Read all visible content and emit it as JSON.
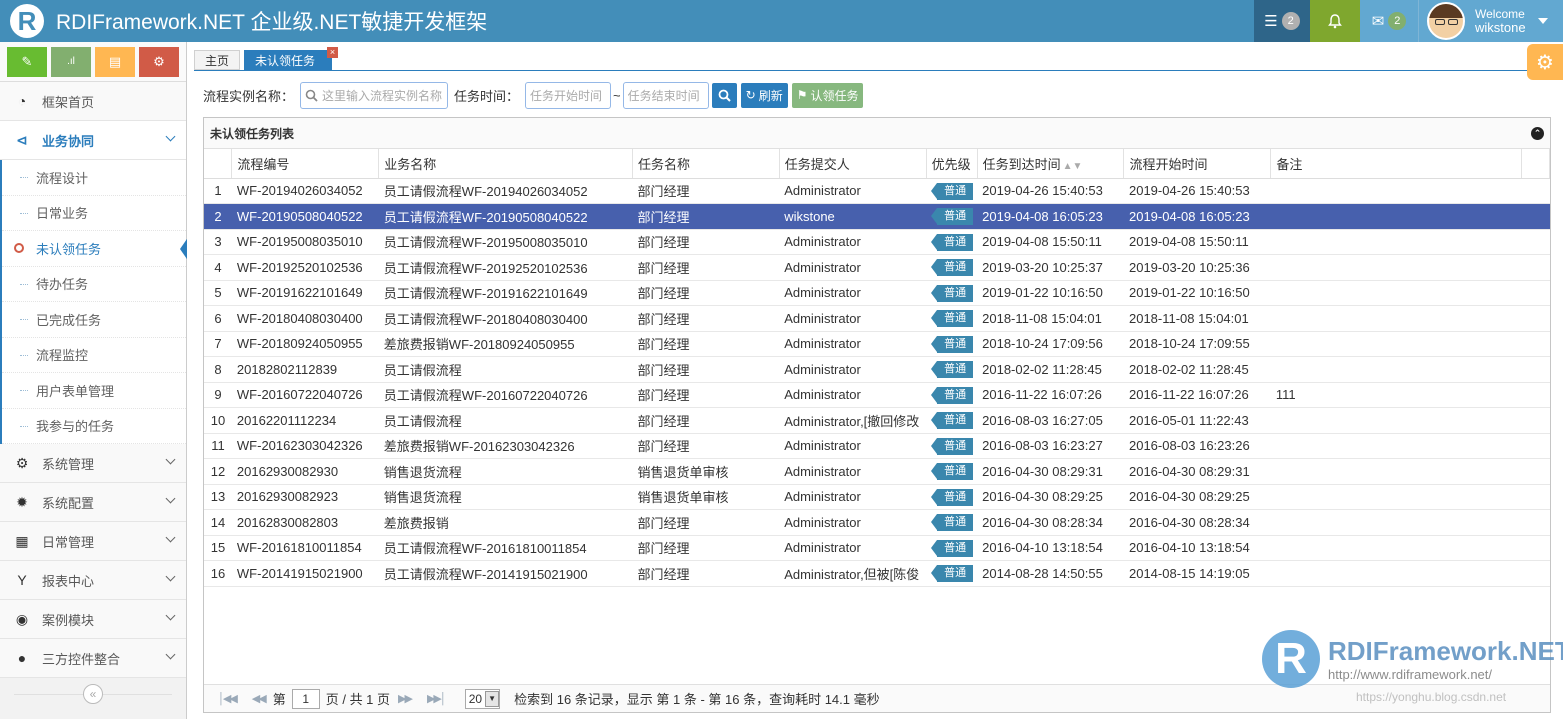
{
  "header": {
    "brand_logo": "R",
    "brand_title": "RDIFramework.NET 企业级.NET敏捷开发框架",
    "tasks_badge": "2",
    "mail_badge": "2",
    "welcome": "Welcome",
    "username": "wikstone"
  },
  "sidebar": {
    "menu": [
      {
        "label": "框架首页",
        "icon": "tachometer-icon"
      },
      {
        "label": "业务协同",
        "icon": "share-icon"
      }
    ],
    "submenu": [
      {
        "label": "流程设计"
      },
      {
        "label": "日常业务"
      },
      {
        "label": "未认领任务"
      },
      {
        "label": "待办任务"
      },
      {
        "label": "已完成任务"
      },
      {
        "label": "流程监控"
      },
      {
        "label": "用户表单管理"
      },
      {
        "label": "我参与的任务"
      }
    ],
    "menu_after": [
      {
        "label": "系统管理"
      },
      {
        "label": "系统配置"
      },
      {
        "label": "日常管理"
      },
      {
        "label": "报表中心"
      },
      {
        "label": "案例模块"
      },
      {
        "label": "三方控件整合"
      }
    ]
  },
  "tabs": {
    "home": "主页",
    "current": "未认领任务",
    "close": "×"
  },
  "toolbar": {
    "instance_label": "流程实例名称：",
    "instance_placeholder": "这里输入流程实例名称",
    "time_label": "任务时间：",
    "start_placeholder": "任务开始时间",
    "range_sep": "~",
    "end_placeholder": "任务结束时间",
    "refresh": "刷新",
    "claim": "认领任务"
  },
  "grid": {
    "title": "未认领任务列表",
    "columns": [
      "流程编号",
      "业务名称",
      "任务名称",
      "任务提交人",
      "优先级",
      "任务到达时间",
      "流程开始时间",
      "备注"
    ],
    "rows": [
      {
        "n": "1",
        "code": "WF-20194026034052",
        "biz": "员工请假流程WF-20194026034052",
        "task": "部门经理",
        "submitter": "Administrator",
        "prio": "普通",
        "arrive": "2019-04-26 15:40:53",
        "start": "2019-04-26 15:40:53",
        "note": ""
      },
      {
        "n": "2",
        "code": "WF-20190508040522",
        "biz": "员工请假流程WF-20190508040522",
        "task": "部门经理",
        "submitter": "wikstone",
        "prio": "普通",
        "arrive": "2019-04-08 16:05:23",
        "start": "2019-04-08 16:05:23",
        "note": ""
      },
      {
        "n": "3",
        "code": "WF-20195008035010",
        "biz": "员工请假流程WF-20195008035010",
        "task": "部门经理",
        "submitter": "Administrator",
        "prio": "普通",
        "arrive": "2019-04-08 15:50:11",
        "start": "2019-04-08 15:50:11",
        "note": ""
      },
      {
        "n": "4",
        "code": "WF-20192520102536",
        "biz": "员工请假流程WF-20192520102536",
        "task": "部门经理",
        "submitter": "Administrator",
        "prio": "普通",
        "arrive": "2019-03-20 10:25:37",
        "start": "2019-03-20 10:25:36",
        "note": ""
      },
      {
        "n": "5",
        "code": "WF-20191622101649",
        "biz": "员工请假流程WF-20191622101649",
        "task": "部门经理",
        "submitter": "Administrator",
        "prio": "普通",
        "arrive": "2019-01-22 10:16:50",
        "start": "2019-01-22 10:16:50",
        "note": ""
      },
      {
        "n": "6",
        "code": "WF-20180408030400",
        "biz": "员工请假流程WF-20180408030400",
        "task": "部门经理",
        "submitter": "Administrator",
        "prio": "普通",
        "arrive": "2018-11-08 15:04:01",
        "start": "2018-11-08 15:04:01",
        "note": ""
      },
      {
        "n": "7",
        "code": "WF-20180924050955",
        "biz": "差旅费报销WF-20180924050955",
        "task": "部门经理",
        "submitter": "Administrator",
        "prio": "普通",
        "arrive": "2018-10-24 17:09:56",
        "start": "2018-10-24 17:09:55",
        "note": ""
      },
      {
        "n": "8",
        "code": "20182802112839",
        "biz": "员工请假流程",
        "task": "部门经理",
        "submitter": "Administrator",
        "prio": "普通",
        "arrive": "2018-02-02 11:28:45",
        "start": "2018-02-02 11:28:45",
        "note": ""
      },
      {
        "n": "9",
        "code": "WF-20160722040726",
        "biz": "员工请假流程WF-20160722040726",
        "task": "部门经理",
        "submitter": "Administrator",
        "prio": "普通",
        "arrive": "2016-11-22 16:07:26",
        "start": "2016-11-22 16:07:26",
        "note": "111"
      },
      {
        "n": "10",
        "code": "20162201112234",
        "biz": "员工请假流程",
        "task": "部门经理",
        "submitter": "Administrator,[撤回修改",
        "prio": "普通",
        "arrive": "2016-08-03 16:27:05",
        "start": "2016-05-01 11:22:43",
        "note": ""
      },
      {
        "n": "11",
        "code": "WF-20162303042326",
        "biz": "差旅费报销WF-20162303042326",
        "task": "部门经理",
        "submitter": "Administrator",
        "prio": "普通",
        "arrive": "2016-08-03 16:23:27",
        "start": "2016-08-03 16:23:26",
        "note": ""
      },
      {
        "n": "12",
        "code": "20162930082930",
        "biz": "销售退货流程",
        "task": "销售退货单审核",
        "submitter": "Administrator",
        "prio": "普通",
        "arrive": "2016-04-30 08:29:31",
        "start": "2016-04-30 08:29:31",
        "note": ""
      },
      {
        "n": "13",
        "code": "20162930082923",
        "biz": "销售退货流程",
        "task": "销售退货单审核",
        "submitter": "Administrator",
        "prio": "普通",
        "arrive": "2016-04-30 08:29:25",
        "start": "2016-04-30 08:29:25",
        "note": ""
      },
      {
        "n": "14",
        "code": "20162830082803",
        "biz": "差旅费报销",
        "task": "部门经理",
        "submitter": "Administrator",
        "prio": "普通",
        "arrive": "2016-04-30 08:28:34",
        "start": "2016-04-30 08:28:34",
        "note": ""
      },
      {
        "n": "15",
        "code": "WF-20161810011854",
        "biz": "员工请假流程WF-20161810011854",
        "task": "部门经理",
        "submitter": "Administrator",
        "prio": "普通",
        "arrive": "2016-04-10 13:18:54",
        "start": "2016-04-10 13:18:54",
        "note": ""
      },
      {
        "n": "16",
        "code": "WF-20141915021900",
        "biz": "员工请假流程WF-20141915021900",
        "task": "部门经理",
        "submitter": "Administrator,但被[陈俊",
        "prio": "普通",
        "arrive": "2014-08-28 14:50:55",
        "start": "2014-08-15 14:19:05",
        "note": ""
      }
    ]
  },
  "pager": {
    "page_prefix": "第",
    "page_value": "1",
    "page_suffix": "页 / 共 1 页",
    "page_size": "20",
    "info": "检索到 16 条记录，显示 第 1 条 - 第 16 条，查询耗时 14.1 毫秒"
  },
  "watermark": {
    "logo": "R",
    "title": "RDIFramework.NET",
    "url": "http://www.rdiframework.net/",
    "blog": "https://yonghu.blog.csdn.net"
  },
  "colors": {
    "navbar": "#438eb9",
    "accent": "#2b7dbc",
    "selected_row": "#4760ad",
    "priority_badge": "#3a87ad"
  }
}
